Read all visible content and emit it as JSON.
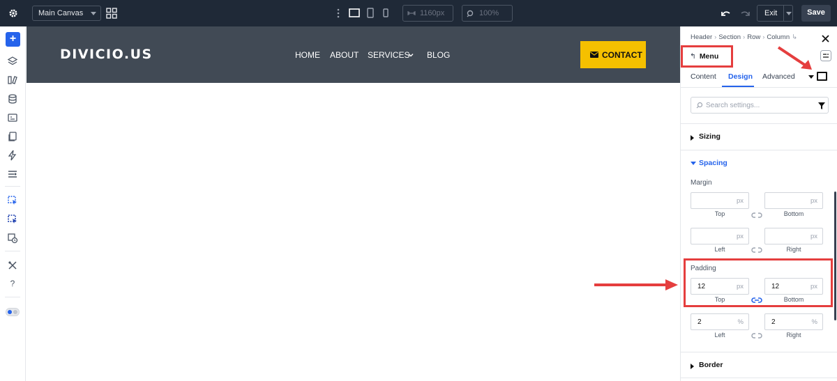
{
  "topbar": {
    "canvas_select": "Main Canvas",
    "width_value": "1160px",
    "zoom_value": "100%",
    "exit_label": "Exit",
    "save_label": "Save"
  },
  "site": {
    "logo": "DIVICIO.US",
    "nav": [
      "HOME",
      "ABOUT",
      "SERVICES",
      "BLOG"
    ],
    "contact": "CONTACT"
  },
  "panel": {
    "breadcrumb": [
      "Header",
      "Section",
      "Row",
      "Column"
    ],
    "module_name": "Menu",
    "tabs": [
      "Content",
      "Design",
      "Advanced"
    ],
    "active_tab": "Design",
    "search_placeholder": "Search settings...",
    "groups": {
      "sizing": "Sizing",
      "spacing": "Spacing",
      "border": "Border"
    },
    "margin": {
      "label": "Margin",
      "top": {
        "value": "",
        "unit": "px",
        "label": "Top"
      },
      "bottom": {
        "value": "",
        "unit": "px",
        "label": "Bottom"
      },
      "left": {
        "value": "",
        "unit": "px",
        "label": "Left"
      },
      "right": {
        "value": "",
        "unit": "px",
        "label": "Right"
      }
    },
    "padding": {
      "label": "Padding",
      "top": {
        "value": "12",
        "unit": "px",
        "label": "Top"
      },
      "bottom": {
        "value": "12",
        "unit": "px",
        "label": "Bottom"
      },
      "left": {
        "value": "2",
        "unit": "%",
        "label": "Left"
      },
      "right": {
        "value": "2",
        "unit": "%",
        "label": "Right"
      }
    }
  },
  "colors": {
    "accent": "#2563eb",
    "topbar_bg": "#1f2937",
    "site_header_bg": "#414a55",
    "contact_bg": "#f5c000",
    "annotation_red": "#e53e3e"
  }
}
